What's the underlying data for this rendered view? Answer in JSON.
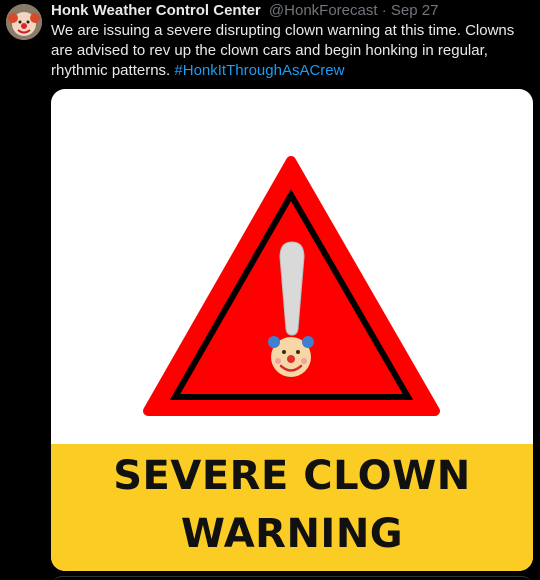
{
  "tweet": {
    "display_name": "Honk Weather Control Center",
    "handle": "@HonkForecast",
    "separator": "·",
    "date": "Sep 27",
    "text": "We are issuing a severe disrupting clown warning at this time. Clowns are advised to rev up the clown cars and begin honking in regular, rhythmic patterns. ",
    "hashtag": "#HonkItThroughAsACrew"
  },
  "media": {
    "banner_line_1": "SEVERE CLOWN",
    "banner_line_2": "WARNING",
    "icons": [
      "warning-triangle-icon",
      "exclamation-mark-icon",
      "clown-face-icon"
    ]
  },
  "colors": {
    "background": "#000000",
    "text": "#e7e9ea",
    "muted": "#71767b",
    "link": "#1d9bf0",
    "triangle_red": "#fe0000",
    "banner_yellow": "#fbcd24"
  }
}
